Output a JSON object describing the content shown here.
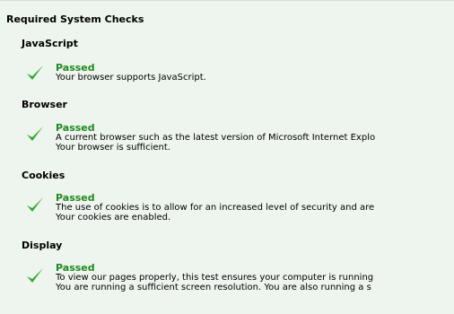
{
  "panel": {
    "title": "Required System Checks"
  },
  "checks": [
    {
      "name": "JavaScript",
      "status": "Passed",
      "lines": [
        "Your browser supports JavaScript."
      ]
    },
    {
      "name": "Browser",
      "status": "Passed",
      "lines": [
        "A current browser such as the latest version of Microsoft Internet Explo",
        "Your browser is sufficient."
      ]
    },
    {
      "name": "Cookies",
      "status": "Passed",
      "lines": [
        "The use of cookies is to allow for an increased level of security and are",
        "Your cookies are enabled."
      ]
    },
    {
      "name": "Display",
      "status": "Passed",
      "lines": [
        "To view our pages properly, this test ensures your computer is running",
        "You are running a sufficient screen resolution. You are also running a s"
      ]
    }
  ],
  "colors": {
    "panel_background": "#eef4ee",
    "status_green": "#1f8a1f",
    "checkmark_green": "#2ea82e"
  },
  "icons": {
    "status": "checkmark-icon"
  }
}
